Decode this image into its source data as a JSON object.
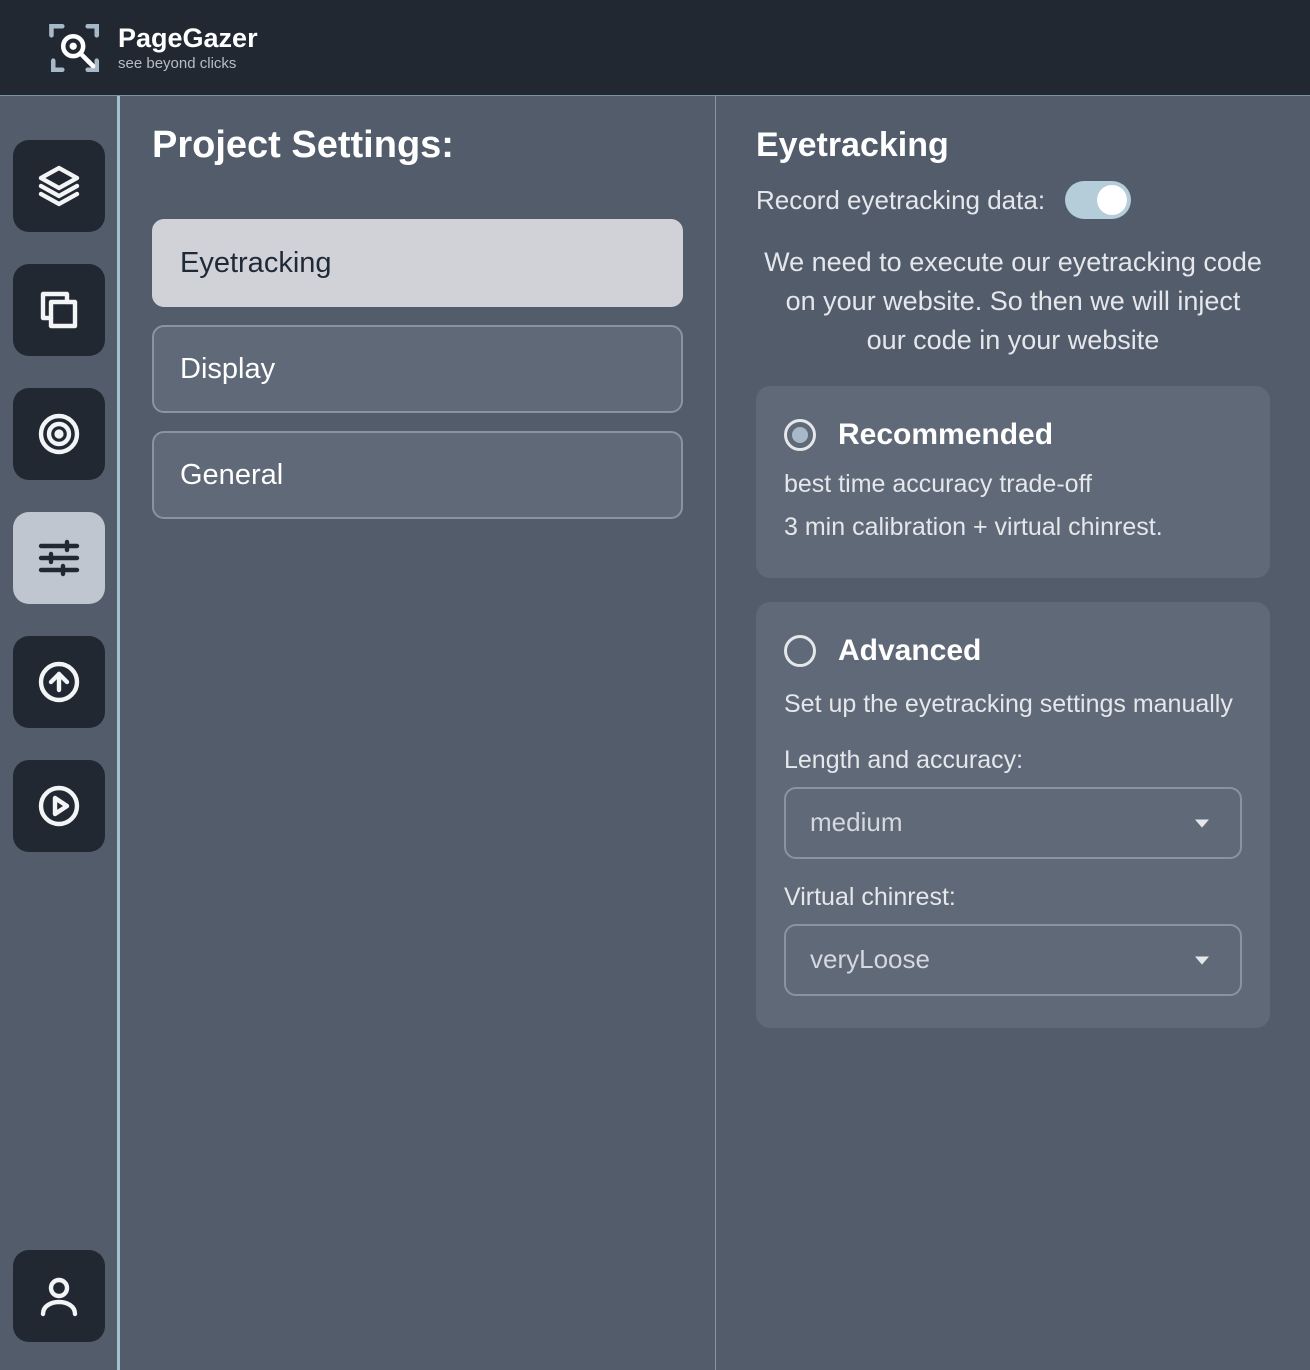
{
  "brand": {
    "title": "PageGazer",
    "subtitle": "see beyond clicks"
  },
  "rail": {
    "items": [
      {
        "name": "layers-icon",
        "label": "Layers"
      },
      {
        "name": "copy-icon",
        "label": "Copy"
      },
      {
        "name": "target-icon",
        "label": "Target"
      },
      {
        "name": "sliders-icon",
        "label": "Settings",
        "selected": true
      },
      {
        "name": "upload-icon",
        "label": "Upload"
      },
      {
        "name": "play-icon",
        "label": "Play"
      }
    ],
    "footer_icon": "user-icon"
  },
  "mid": {
    "title": "Project Settings:",
    "tabs": [
      {
        "label": "Eyetracking",
        "active": true
      },
      {
        "label": "Display"
      },
      {
        "label": "General"
      }
    ]
  },
  "right": {
    "heading": "Eyetracking",
    "toggle_label": "Record eyetracking data:",
    "toggle_on": true,
    "blurb": "We need to execute our eyetracking code on your website. So then we will inject our code in your website",
    "recommended": {
      "title": "Recommended",
      "selected": true,
      "sub": "best time accuracy trade-off",
      "desc": "3 min calibration + virtual chinrest."
    },
    "advanced": {
      "title": "Advanced",
      "selected": false,
      "desc": "Set up the eyetracking settings manually",
      "length_label": "Length and accuracy:",
      "length_value": "medium",
      "chinrest_label": "Virtual chinrest:",
      "chinrest_value": "veryLoose"
    }
  }
}
